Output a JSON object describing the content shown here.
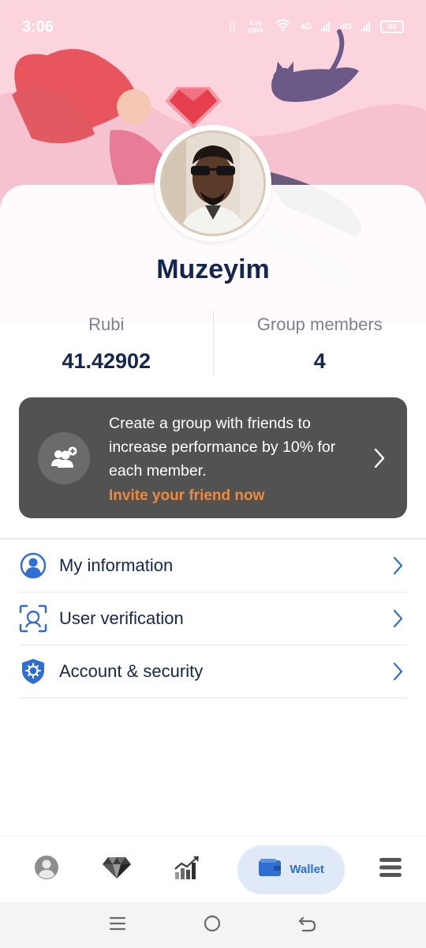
{
  "status_bar": {
    "time": "3:06",
    "net_speed": "3.09 KB/S",
    "network_1": "4G",
    "network_2": "4G",
    "battery": "40"
  },
  "profile": {
    "username": "Muzeyim"
  },
  "stats": [
    {
      "label": "Rubi",
      "value": "41.42902"
    },
    {
      "label": "Group members",
      "value": "4"
    }
  ],
  "invite": {
    "description": "Create a group with friends to increase performance by 10% for each member.",
    "link_text": "Invite your friend now",
    "link_color": "#f0893a"
  },
  "menu": [
    {
      "label": "My information",
      "icon": "user-circle-icon"
    },
    {
      "label": "User verification",
      "icon": "face-scan-icon"
    },
    {
      "label": "Account & security",
      "icon": "shield-gear-icon"
    }
  ],
  "bottom_nav": {
    "items": [
      {
        "icon": "profile-icon"
      },
      {
        "icon": "diamond-icon"
      },
      {
        "icon": "chart-icon"
      },
      {
        "icon": "wallet-icon",
        "label": "Wallet",
        "active": true
      },
      {
        "icon": "menu-icon"
      }
    ]
  },
  "colors": {
    "accent": "#2f6fd1",
    "title": "#13264d",
    "card_bg": "#525252",
    "hero_bg": "#fbd4de"
  }
}
